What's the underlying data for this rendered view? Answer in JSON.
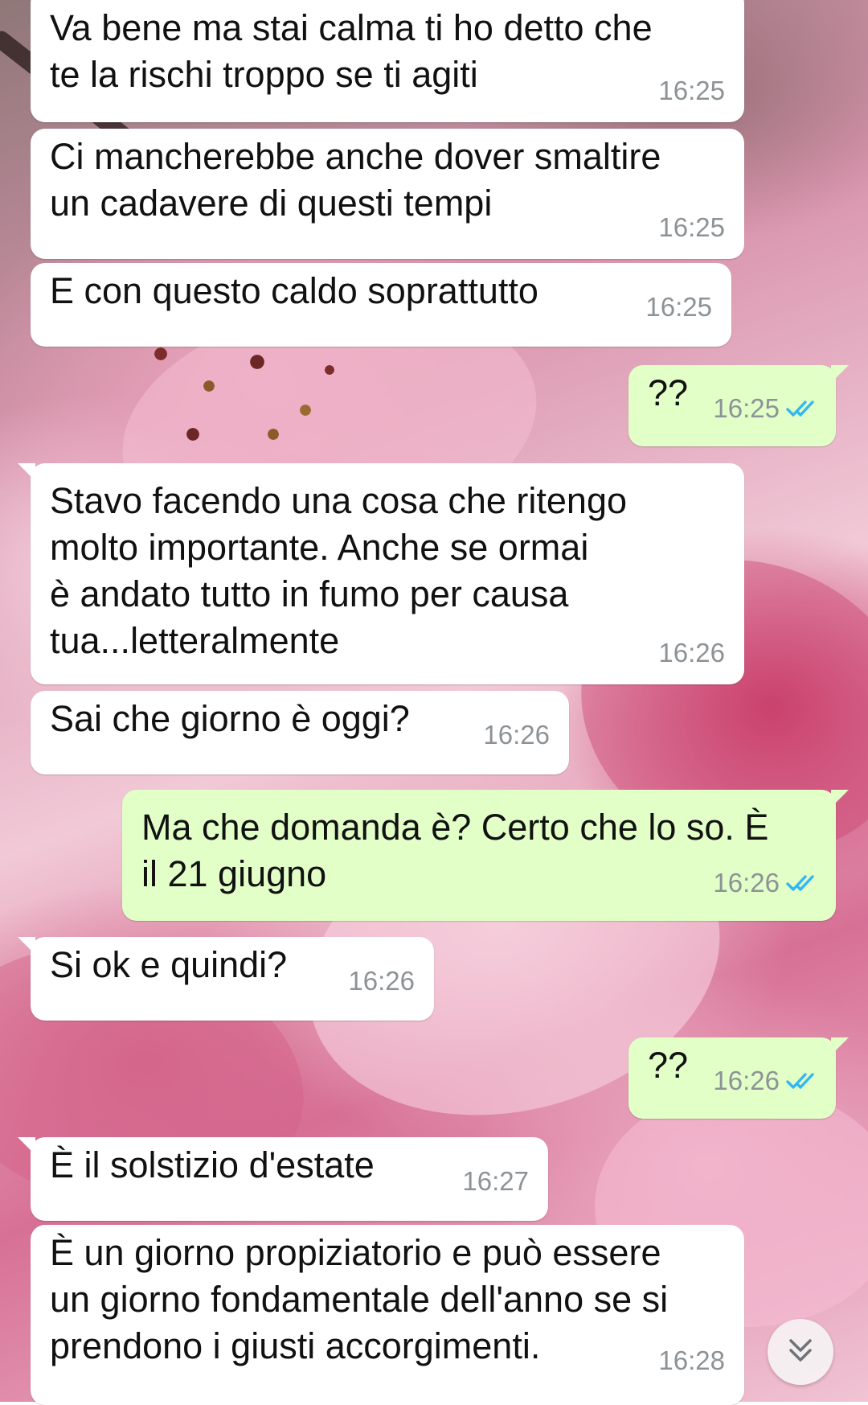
{
  "messages": [
    {
      "direction": "in",
      "text": "Va bene ma stai calma ti ho detto che\nte la rischi troppo se ti agiti",
      "time": "16:25"
    },
    {
      "direction": "in",
      "text": "Ci mancherebbe anche dover smaltire\nun cadavere di questi tempi",
      "time": "16:25"
    },
    {
      "direction": "in",
      "text": "E con questo caldo soprattutto",
      "time": "16:25"
    },
    {
      "direction": "out",
      "text": "??",
      "time": "16:25",
      "status": "read"
    },
    {
      "direction": "in",
      "text": "Stavo facendo una cosa che ritengo\nmolto importante. Anche se ormai\nè andato tutto in fumo per causa\ntua...letteralmente",
      "time": "16:26"
    },
    {
      "direction": "in",
      "text": "Sai che giorno è oggi?",
      "time": "16:26"
    },
    {
      "direction": "out",
      "text": "Ma che domanda è? Certo che lo so. È\nil 21 giugno",
      "time": "16:26",
      "status": "read"
    },
    {
      "direction": "in",
      "text": "Si ok e quindi?",
      "time": "16:26"
    },
    {
      "direction": "out",
      "text": "??",
      "time": "16:26",
      "status": "read"
    },
    {
      "direction": "in",
      "text": "È il solstizio d'estate",
      "time": "16:27"
    },
    {
      "direction": "in",
      "text": "È un giorno propiziatorio e può essere\nun giorno fondamentale dell'anno se si\nprendono i giusti accorgimenti.",
      "time": "16:28"
    }
  ],
  "colors": {
    "incoming_bubble": "#ffffff",
    "outgoing_bubble": "#e2ffc8",
    "read_tick": "#34b7f1",
    "timestamp": "#8d9296"
  },
  "icons": {
    "read_receipt": "double-check-icon",
    "scroll_down": "chevron-double-down-icon"
  }
}
